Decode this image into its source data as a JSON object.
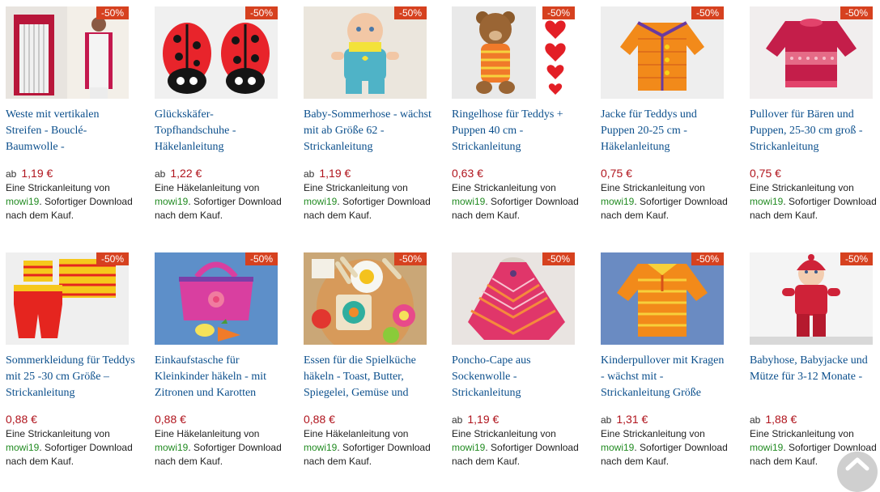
{
  "colors": {
    "badge": "#d6411f",
    "title_link": "#0b4f8c",
    "price": "#b0141d",
    "seller": "#228b22"
  },
  "products": [
    {
      "badge": "-50%",
      "title": "Weste mit vertikalen Streifen - Bouclé-Baumwolle -",
      "prefix": "ab",
      "price": "1,19 €",
      "desc_before": "Eine Strickanleitung von",
      "seller": "mowi19",
      "desc_after": ". Sofortiger Download nach dem Kauf.",
      "image": "vest-image"
    },
    {
      "badge": "-50%",
      "title": "Glückskäfer-Topfhandschuhe - Häkelanleitung",
      "prefix": "ab",
      "price": "1,22 €",
      "desc_before": "Eine Häkelanleitung von",
      "seller": "mowi19",
      "desc_after": ". Sofortiger Download nach dem Kauf.",
      "image": "ladybug-image"
    },
    {
      "badge": "-50%",
      "title": "Baby-Sommerhose - wächst mit ab Größe 62 - Strickanleitung",
      "prefix": "ab",
      "price": "1,19 €",
      "desc_before": "Eine Strickanleitung von",
      "seller": "mowi19",
      "desc_after": ". Sofortiger Download nach dem Kauf.",
      "image": "baby-doll-image"
    },
    {
      "badge": "-50%",
      "title": "Ringelhose für Teddys + Puppen 40 cm - Strickanleitung",
      "prefix": "",
      "price": "0,63 €",
      "desc_before": "Eine Strickanleitung von",
      "seller": "mowi19",
      "desc_after": ". Sofortiger Download nach dem Kauf.",
      "image": "teddy-image"
    },
    {
      "badge": "-50%",
      "title": "Jacke für Teddys und Puppen 20-25 cm - Häkelanleitung",
      "prefix": "",
      "price": "0,75 €",
      "desc_before": "Eine Strickanleitung von",
      "seller": "mowi19",
      "desc_after": ". Sofortiger Download nach dem Kauf.",
      "image": "orange-jacket-image"
    },
    {
      "badge": "-50%",
      "title": "Pullover für Bären und Puppen, 25-30 cm groß - Strickanleitung",
      "prefix": "",
      "price": "0,75 €",
      "desc_before": "Eine Strickanleitung von",
      "seller": "mowi19",
      "desc_after": ". Sofortiger Download nach dem Kauf.",
      "image": "pink-pullover-image"
    },
    {
      "badge": "-50%",
      "title": "Sommerkleidung für Teddys mit 25 -30 cm Größe – Strickanleitung",
      "prefix": "",
      "price": "0,88 €",
      "desc_before": "Eine Strickanleitung von",
      "seller": "mowi19",
      "desc_after": ". Sofortiger Download nach dem Kauf.",
      "image": "summer-clothes-image"
    },
    {
      "badge": "-50%",
      "title": "Einkaufstasche für Kleinkinder häkeln - mit Zitronen und Karotten",
      "prefix": "",
      "price": "0,88 €",
      "desc_before": "Eine Häkelanleitung von",
      "seller": "mowi19",
      "desc_after": ". Sofortiger Download nach dem Kauf.",
      "image": "shopping-bag-image"
    },
    {
      "badge": "-50%",
      "title": "Essen für die Spielküche häkeln - Toast, Butter, Spiegelei, Gemüse und",
      "prefix": "",
      "price": "0,88 €",
      "desc_before": "Eine Häkelanleitung von",
      "seller": "mowi19",
      "desc_after": ". Sofortiger Download nach dem Kauf.",
      "image": "play-food-image"
    },
    {
      "badge": "-50%",
      "title": "Poncho-Cape aus Sockenwolle - Strickanleitung",
      "prefix": "ab",
      "price": "1,19 €",
      "desc_before": "Eine Strickanleitung von",
      "seller": "mowi19",
      "desc_after": ". Sofortiger Download nach dem Kauf.",
      "image": "poncho-image"
    },
    {
      "badge": "-50%",
      "title": "Kinderpullover mit Kragen - wächst mit - Strickanleitung Größe",
      "prefix": "ab",
      "price": "1,31 €",
      "desc_before": "Eine Strickanleitung von",
      "seller": "mowi19",
      "desc_after": ". Sofortiger Download nach dem Kauf.",
      "image": "kids-sweater-image"
    },
    {
      "badge": "-50%",
      "title": "Babyhose, Babyjacke und Mütze für 3-12 Monate -",
      "prefix": "ab",
      "price": "1,88 €",
      "desc_before": "Eine Strickanleitung von",
      "seller": "mowi19",
      "desc_after": ". Sofortiger Download nach dem Kauf.",
      "image": "baby-outfit-image"
    }
  ],
  "scroll_top": {
    "icon": "chevron-up-icon"
  }
}
